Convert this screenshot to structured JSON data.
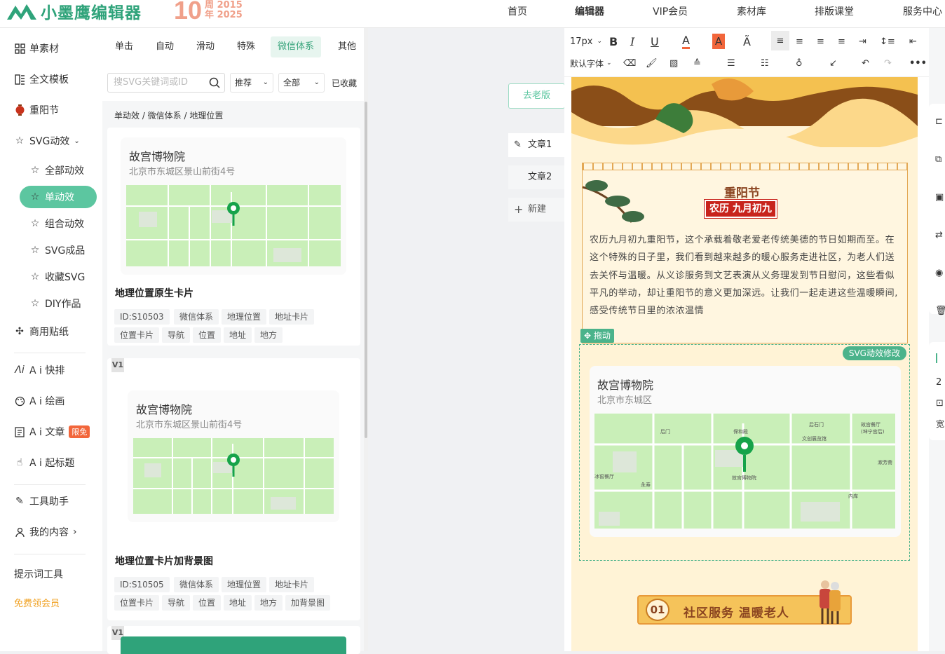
{
  "brand": {
    "name": "小墨鹰编辑器",
    "anniv_num": "10",
    "anniv_line1": "周 2015",
    "anniv_line2": "年 2025"
  },
  "nav": [
    "首页",
    "编辑器",
    "VIP会员",
    "素材库",
    "排版课堂",
    "服务中心"
  ],
  "sidebar": {
    "items": [
      {
        "label": "单素材",
        "icon": "grid-icon"
      },
      {
        "label": "全文模板",
        "icon": "template-icon"
      },
      {
        "label": "重阳节",
        "icon": "lantern-icon"
      },
      {
        "label": "SVG动效",
        "icon": "star-icon"
      },
      {
        "label": "全部动效",
        "icon": "star-icon"
      },
      {
        "label": "单动效",
        "icon": "star-icon"
      },
      {
        "label": "组合动效",
        "icon": "star-icon"
      },
      {
        "label": "SVG成品",
        "icon": "star-icon"
      },
      {
        "label": "收藏SVG",
        "icon": "star-icon"
      },
      {
        "label": "DIY作品",
        "icon": "star-icon"
      },
      {
        "label": "商用贴纸",
        "icon": "puzzle-icon"
      },
      {
        "label": "A i 快排",
        "icon": "ai-icon"
      },
      {
        "label": "A i 绘画",
        "icon": "palette-icon"
      },
      {
        "label": "A i 文章",
        "icon": "doc-icon",
        "badge": "限免"
      },
      {
        "label": "A i 起标题",
        "icon": "hand-icon"
      },
      {
        "label": "工具助手",
        "icon": "tool-icon"
      },
      {
        "label": "我的内容",
        "icon": "user-icon"
      },
      {
        "label": "提示词工具",
        "icon": ""
      },
      {
        "label": "免费领会员",
        "icon": ""
      }
    ]
  },
  "panel": {
    "tabs": [
      "单击",
      "自动",
      "滑动",
      "特殊",
      "微信体系",
      "其他"
    ],
    "search_placeholder": "搜SVG关键词或ID",
    "dropdown1": "推荐",
    "dropdown2": "全部",
    "favorites": "已收藏",
    "breadcrumb": "单动效  /  微信体系  /  地理位置",
    "cards": [
      {
        "place": "故宫博物院",
        "address": "北京市东城区景山前街4号",
        "title": "地理位置原生卡片",
        "tags": [
          "ID:S10503",
          "微信体系",
          "地理位置",
          "地址卡片",
          "位置卡片",
          "导航",
          "位置",
          "地址",
          "地方"
        ]
      },
      {
        "place": "故宫博物院",
        "address": "北京市东城区景山前街4号",
        "title": "地理位置卡片加背景图",
        "tags": [
          "ID:S10505",
          "微信体系",
          "地理位置",
          "地址卡片",
          "位置卡片",
          "导航",
          "位置",
          "地址",
          "地方",
          "加背景图"
        ]
      }
    ],
    "vbadge": "V1"
  },
  "center": {
    "old_version": "去老版",
    "articles": [
      "文章1",
      "文章2"
    ],
    "new": "新建"
  },
  "toolbar": {
    "font_size": "17px",
    "font_family": "默认字体"
  },
  "doc": {
    "heading": "重阳节",
    "subheading": "农历 九月初九",
    "body": "农历九月初九重阳节，这个承载着敬老爱老传统美德的节日如期而至。在这个特殊的日子里，我们看到越来越多的暖心服务走进社区，为老人们送去关怀与温暖。从义诊服务到文艺表演从义务理发到节日慰问，这些看似平凡的举动，却让重阳节的意义更加深远。让我们一起走进这些温暖瞬间,感受传统节日里的浓浓温情",
    "drag_label": "拖动",
    "svg_edit": "SVG动效修改",
    "map_place": "故宫博物院",
    "map_address": "北京市东城区",
    "section_num": "01",
    "section_title": "社区服务 温暖老人"
  },
  "map_labels": [
    "后门",
    "保和殿",
    "后石门",
    "文创展览馆",
    "故宫餐厅",
    "(坤宁宫后)",
    "冰窖餐厅",
    "永寿",
    "故宫博物院",
    "漱芳斋",
    "内库"
  ],
  "rightrail": {
    "text1": "2",
    "text2": "宽"
  }
}
